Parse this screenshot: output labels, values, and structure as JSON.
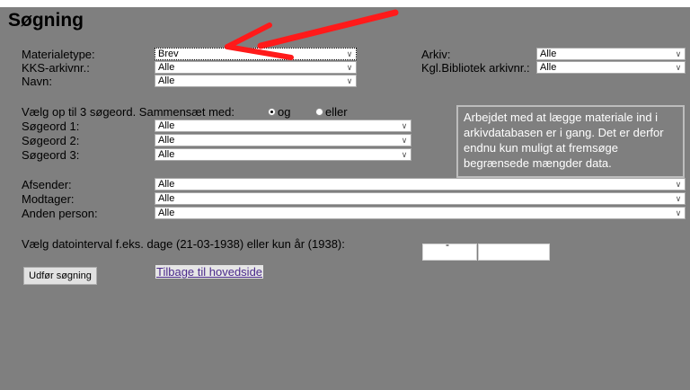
{
  "page_title": "Søgning",
  "fields": {
    "materialetype": {
      "label": "Materialetype:",
      "value": "Brev"
    },
    "kks": {
      "label": "KKS-arkivnr.:",
      "value": "Alle"
    },
    "navn": {
      "label": "Navn:",
      "value": "Alle"
    },
    "arkiv": {
      "label": "Arkiv:",
      "value": "Alle"
    },
    "kgl": {
      "label": "Kgl.Bibliotek arkivnr.:",
      "value": "Alle"
    }
  },
  "search_words": {
    "intro": "Vælg op til 3 søgeord. Sammensæt med:",
    "opt_og": "og",
    "opt_eller": "eller",
    "rows": [
      {
        "label": "Søgeord 1:",
        "value": "Alle"
      },
      {
        "label": "Søgeord 2:",
        "value": "Alle"
      },
      {
        "label": "Søgeord 3:",
        "value": "Alle"
      }
    ]
  },
  "note": "Arbejdet med at lægge materiale ind i arkivdatabasen er i gang. Det er derfor endnu kun muligt at fremsøge begrænsede mængder data.",
  "persons": [
    {
      "label": "Afsender:",
      "value": "Alle"
    },
    {
      "label": "Modtager:",
      "value": "Alle"
    },
    {
      "label": "Anden person:",
      "value": "Alle"
    }
  ],
  "date": {
    "label": "Vælg datointerval f.eks. dage (21-03-1938) eller kun år (1938):",
    "separator": "-"
  },
  "submit_label": "Udfør søgning",
  "back_link": "Tilbage til hovedside",
  "annotation": {
    "arrow_color": "#ff1a1a"
  }
}
